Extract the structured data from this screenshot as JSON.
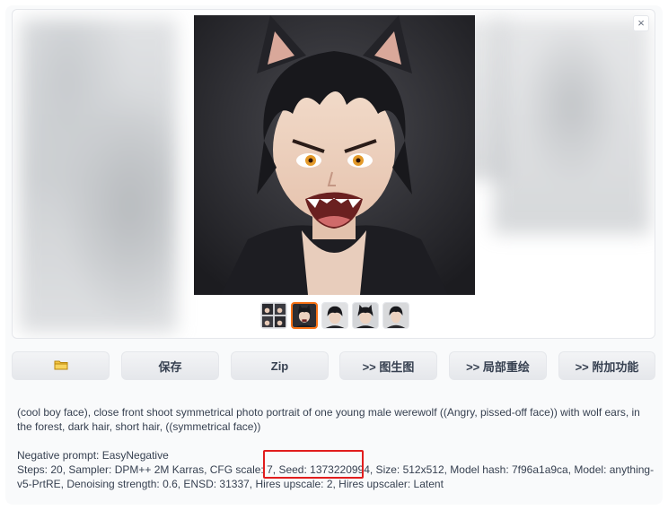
{
  "gallery": {
    "close_label": "×",
    "thumbnails": [
      {
        "name": "thumb-grid",
        "selected": false
      },
      {
        "name": "thumb-angry-boy",
        "selected": true
      },
      {
        "name": "thumb-boy-2",
        "selected": false
      },
      {
        "name": "thumb-boy-3",
        "selected": false
      },
      {
        "name": "thumb-boy-4",
        "selected": false
      }
    ]
  },
  "buttons": {
    "folder_icon": "folder-icon",
    "save_label": "保存",
    "zip_label": "Zip",
    "img2img_label": ">> 图生图",
    "inpaint_label": ">> 局部重绘",
    "extras_label": ">> 附加功能"
  },
  "info": {
    "prompt": "(cool boy face), close front shoot symmetrical photo portrait of one young male werewolf ((Angry, pissed-off face)) with wolf ears, in the forest, dark hair, short hair, ((symmetrical face))",
    "negative": "Negative prompt: EasyNegative",
    "params_before_seed": "Steps: 20, Sampler: DPM++ 2M Karras, CFG scale: 7, ",
    "seed": "Seed: 1373220994",
    "params_after_seed": ", Size: 512x512, Model hash: 7f96a1a9ca, Model: anything-v5-PrtRE, Denoising strength: 0.6, ENSD: 31337, Hires upscale: 2, Hires upscaler: Latent"
  },
  "colors": {
    "accent_selected": "#f97316",
    "highlight_box": "#e11d1d"
  }
}
